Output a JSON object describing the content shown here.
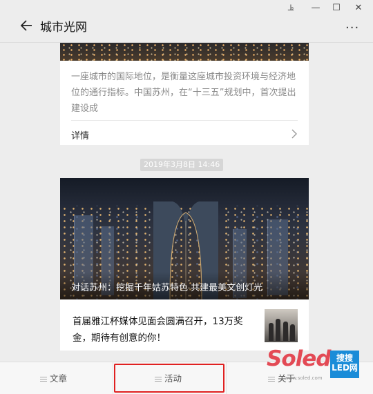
{
  "window": {
    "pin_glyph": "⫡",
    "minimize_glyph": "—",
    "maximize_glyph": "☐",
    "close_glyph": "✕"
  },
  "header": {
    "title": "城市光网",
    "more_glyph": "···"
  },
  "card1": {
    "description": "一座城市的国际地位，是衡量这座城市投资环境与经济地位的通行指标。中国苏州，在“十三五”规划中，首次提出建设成",
    "detail_label": "详情"
  },
  "timestamp": "2019年3月8日 14:46",
  "card2": {
    "hero_caption": "对话苏州：挖掘千年姑苏特色 共建最美文创灯光",
    "article_title": "首届雅江杯媒体见面会圆满召开，13万奖金，期待有创意的你！"
  },
  "menu": {
    "items": [
      "文章",
      "活动",
      "关于"
    ]
  },
  "watermark": {
    "brand": "Soled",
    "box_top": "搜搜",
    "box_bottom": "LED网",
    "url": "www.soled.com"
  },
  "colors": {
    "highlight": "#e02020",
    "watermark_red": "#e34a55",
    "watermark_blue": "#1a8cd8"
  }
}
